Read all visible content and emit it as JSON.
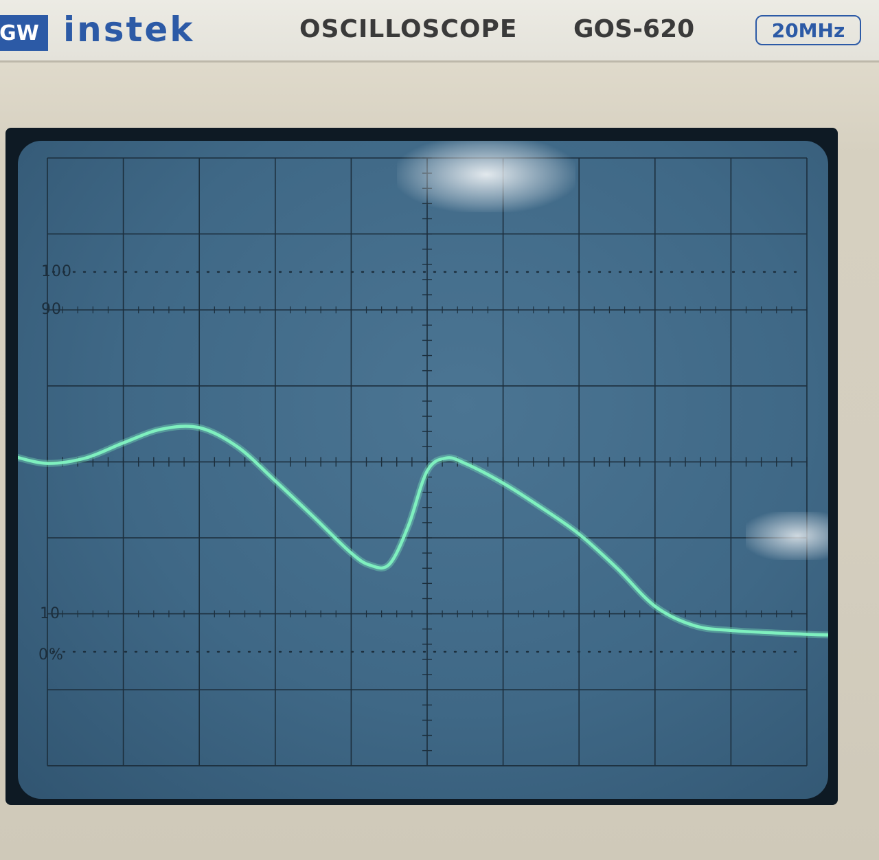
{
  "brand": {
    "logo_text": "GW",
    "name": "instek",
    "product_type": "OSCILLOSCOPE",
    "model": "GOS-620",
    "bandwidth": "20MHz"
  },
  "graticule_labels": {
    "rise_top": "100",
    "rise_upper": "90",
    "rise_lower": "10",
    "rise_bottom": "0%"
  },
  "colors": {
    "brand_blue": "#2c5aa6",
    "trace": "#7ff0bf",
    "screen": "#3f6886",
    "bezel": "#d6d0c0"
  },
  "trace_shape": {
    "description_divisions": "horizontal 0-10 divs, vertical 0-8 divs from bottom",
    "points": [
      [
        -0.4,
        4.06
      ],
      [
        0.0,
        3.98
      ],
      [
        0.5,
        4.05
      ],
      [
        1.0,
        4.25
      ],
      [
        1.5,
        4.43
      ],
      [
        2.0,
        4.45
      ],
      [
        2.5,
        4.2
      ],
      [
        3.0,
        3.75
      ],
      [
        3.5,
        3.28
      ],
      [
        4.0,
        2.8
      ],
      [
        4.25,
        2.64
      ],
      [
        4.5,
        2.65
      ],
      [
        4.75,
        3.15
      ],
      [
        5.0,
        3.88
      ],
      [
        5.25,
        4.05
      ],
      [
        5.5,
        3.98
      ],
      [
        6.0,
        3.72
      ],
      [
        6.5,
        3.4
      ],
      [
        7.0,
        3.05
      ],
      [
        7.5,
        2.6
      ],
      [
        8.0,
        2.1
      ],
      [
        8.5,
        1.85
      ],
      [
        9.0,
        1.78
      ],
      [
        10.0,
        1.73
      ],
      [
        10.4,
        1.72
      ]
    ]
  }
}
